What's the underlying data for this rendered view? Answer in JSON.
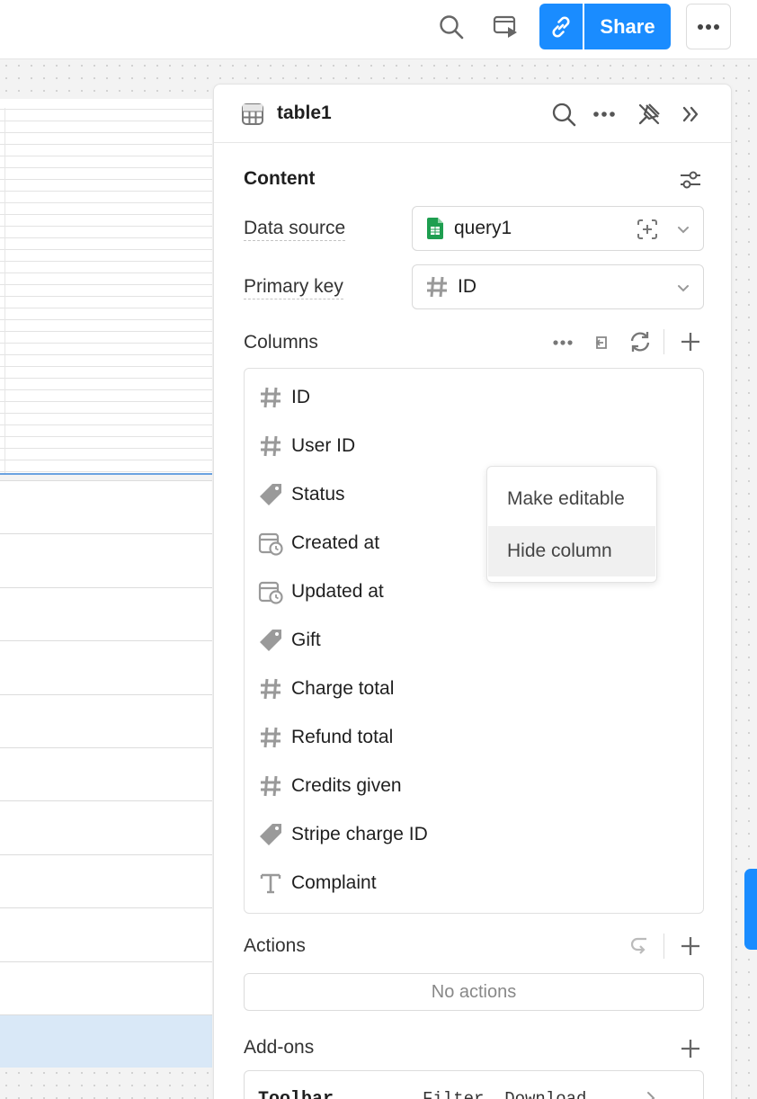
{
  "toolbar": {
    "share_label": "Share"
  },
  "panel": {
    "title": "table1",
    "content_title": "Content",
    "data_source": {
      "label": "Data source",
      "value": "query1"
    },
    "primary_key": {
      "label": "Primary key",
      "value": "ID"
    },
    "columns_title": "Columns",
    "columns": [
      {
        "label": "ID",
        "icon": "hash-icon"
      },
      {
        "label": "User ID",
        "icon": "hash-icon"
      },
      {
        "label": "Status",
        "icon": "tag-icon"
      },
      {
        "label": "Created at",
        "icon": "calendar-clock-icon"
      },
      {
        "label": "Updated at",
        "icon": "calendar-clock-icon"
      },
      {
        "label": "Gift",
        "icon": "tag-icon"
      },
      {
        "label": "Charge total",
        "icon": "hash-icon"
      },
      {
        "label": "Refund total",
        "icon": "hash-icon"
      },
      {
        "label": "Credits given",
        "icon": "hash-icon"
      },
      {
        "label": "Stripe charge ID",
        "icon": "tag-icon"
      },
      {
        "label": "Complaint",
        "icon": "text-icon"
      }
    ],
    "context_menu": {
      "items": [
        "Make editable",
        "Hide column"
      ],
      "highlighted": "Hide column"
    },
    "actions_title": "Actions",
    "no_actions": "No actions",
    "addons_title": "Add-ons",
    "addons": [
      {
        "name": "Toolbar",
        "value": "Filter, Download"
      }
    ]
  },
  "colors": {
    "accent": "#1a8cff",
    "selected_row": "#d9e8f7",
    "sheets_green": "#1e9e50"
  }
}
